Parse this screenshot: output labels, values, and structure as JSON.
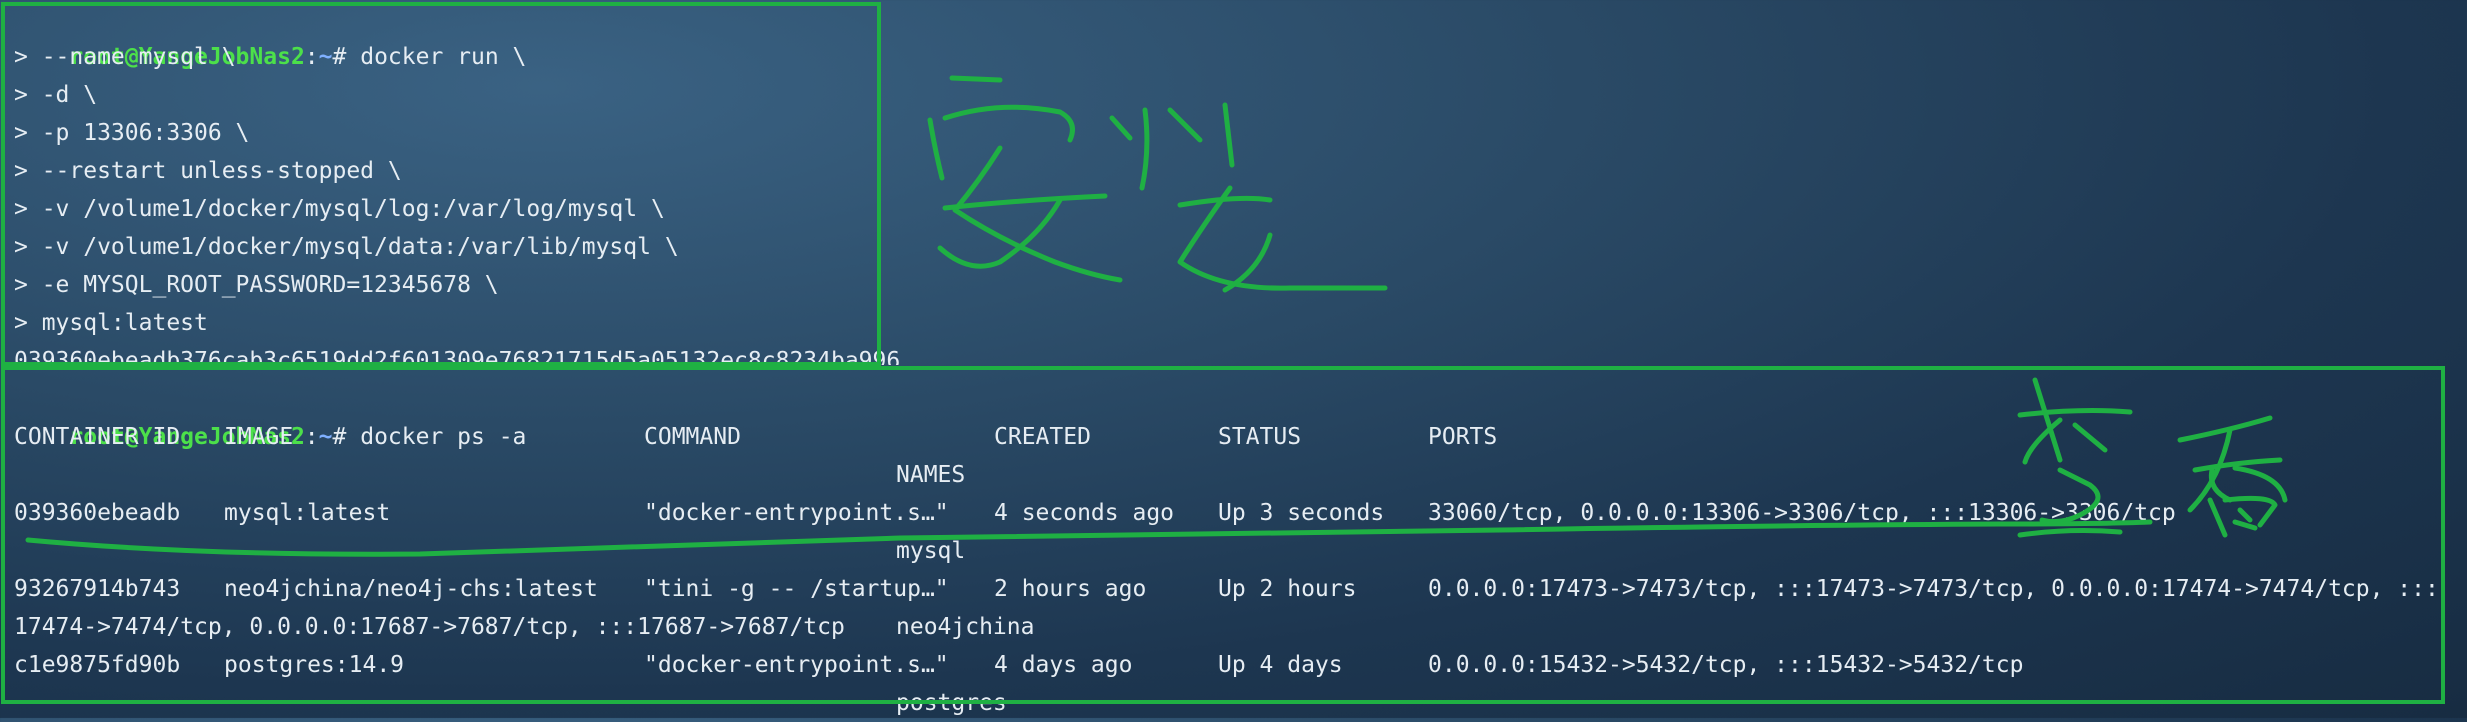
{
  "terminal": {
    "prompt_user": "root@YangeJobNas2",
    "prompt_sep": ":",
    "prompt_path": "~",
    "prompt_hash": "# ",
    "run_command": {
      "lines": [
        "docker run \\",
        "> --name mysql \\",
        "> -d \\",
        "> -p 13306:3306 \\",
        "> --restart unless-stopped \\",
        "> -v /volume1/docker/mysql/log:/var/log/mysql \\",
        "> -v /volume1/docker/mysql/data:/var/lib/mysql \\",
        "> -e MYSQL_ROOT_PASSWORD=12345678 \\",
        "> mysql:latest",
        "039360ebeadb376cab3c6519dd2f601309e76821715d5a05132ec8c8234ba996"
      ]
    },
    "ps_command": "docker ps -a",
    "ps_table": {
      "headers": [
        "CONTAINER ID",
        "IMAGE",
        "COMMAND",
        "CREATED",
        "STATUS",
        "PORTS",
        "NAMES"
      ],
      "rows": [
        {
          "container_id": "039360ebeadb",
          "image": "mysql:latest",
          "command": "\"docker-entrypoint.s…\"",
          "created": "4 seconds ago",
          "status": "Up 3 seconds",
          "ports": "33060/tcp, 0.0.0.0:13306->3306/tcp, :::13306->3306/tcp",
          "name": "mysql"
        },
        {
          "container_id": "93267914b743",
          "image": "neo4jchina/neo4j-chs:latest",
          "command": "\"tini -g -- /startup…\"",
          "created": "2 hours ago",
          "status": "Up 2 hours",
          "ports": "0.0.0.0:17473->7473/tcp, :::17473->7473/tcp, 0.0.0.0:17474->7474/tcp, :::",
          "ports_cont": "17474->7474/tcp, 0.0.0.0:17687->7687/tcp, :::17687->7687/tcp",
          "name": "neo4jchina"
        },
        {
          "container_id": "c1e9875fd90b",
          "image": "postgres:14.9",
          "command": "\"docker-entrypoint.s…\"",
          "created": "4 days ago",
          "status": "Up 4 days",
          "ports": "0.0.0.0:15432->5432/tcp, :::15432->5432/tcp",
          "name": "postgres"
        }
      ]
    }
  },
  "annotations": {
    "install_label": "安装",
    "view_label": "查看",
    "color": "#1fb043"
  }
}
